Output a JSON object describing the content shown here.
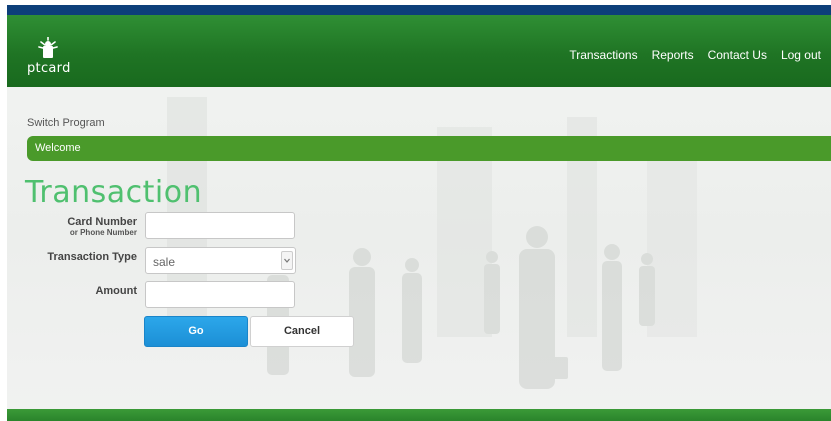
{
  "header": {
    "logo_text": "ptcard",
    "nav": [
      "Transactions",
      "Reports",
      "Contact Us",
      "Log out"
    ]
  },
  "subheader": {
    "switch_program": "Switch Program",
    "welcome": "Welcome"
  },
  "form": {
    "title": "Transaction",
    "card_number_label": "Card Number",
    "card_number_sublabel": "or Phone Number",
    "card_number_value": "",
    "transaction_type_label": "Transaction Type",
    "transaction_type_value": "sale",
    "amount_label": "Amount",
    "amount_value": "",
    "go_label": "Go",
    "cancel_label": "Cancel"
  },
  "colors": {
    "header_green": "#1f7424",
    "top_strip_blue": "#0d3f7a",
    "welcome_green": "#4a9a2a",
    "title_green": "#4fc06f",
    "go_blue": "#2ca7ea"
  },
  "icons": {
    "logo": "ptcard-logo-icon",
    "select_arrow": "chevron-down-icon"
  }
}
